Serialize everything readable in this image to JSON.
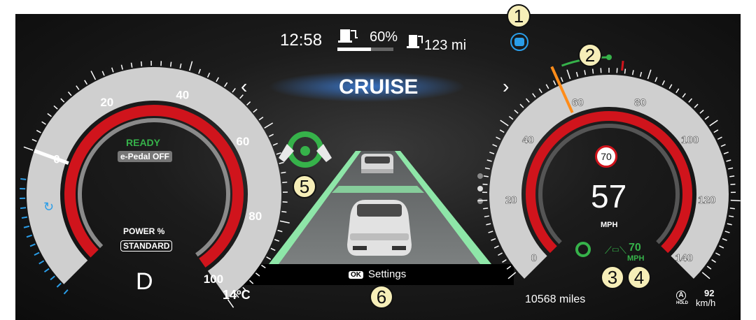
{
  "top_bar": {
    "time": "12:58",
    "battery_percent": "60%",
    "battery_fraction": 0.6,
    "range": "123 mi"
  },
  "mode": {
    "title": "CRUISE",
    "prev_arrow": "‹",
    "next_arrow": "›"
  },
  "power_gauge": {
    "ticks": [
      "0",
      "20",
      "40",
      "60",
      "80",
      "100"
    ],
    "ready": "READY",
    "epedal": "e-Pedal OFF",
    "power_label": "POWER %",
    "drive_mode": "STANDARD",
    "gear": "D"
  },
  "speedometer": {
    "ticks": [
      "0",
      "20",
      "40",
      "60",
      "80",
      "100",
      "120",
      "140"
    ],
    "speed_limit": "70",
    "speed": "57",
    "unit": "MPH",
    "set_speed": "70",
    "set_speed_unit": "MPH"
  },
  "bottom_bar": {
    "temperature": "14ºC",
    "ok_badge": "OK",
    "settings": "Settings",
    "odometer": "10568 miles",
    "kmh_value": "92",
    "kmh_unit": "km/h",
    "auto_hold": "A",
    "auto_hold_sub": "HOLD"
  },
  "callouts": [
    "1",
    "2",
    "3",
    "4",
    "5",
    "6"
  ],
  "colors": {
    "accent_green": "#36b24a",
    "lane_green": "#8ee6a8",
    "gauge_red": "#d0141c",
    "info_blue": "#2a9de8",
    "callout_fill": "#f6eeb8",
    "orange_needle": "#ff8c1a"
  },
  "icons": {
    "battery": "ev-charge-icon",
    "range": "fuel-pump-icon",
    "assist": "steering-assist-icon",
    "lane": "lane-keep-icon",
    "regen": "regen-icon",
    "driver": "driver-monitor-icon"
  }
}
